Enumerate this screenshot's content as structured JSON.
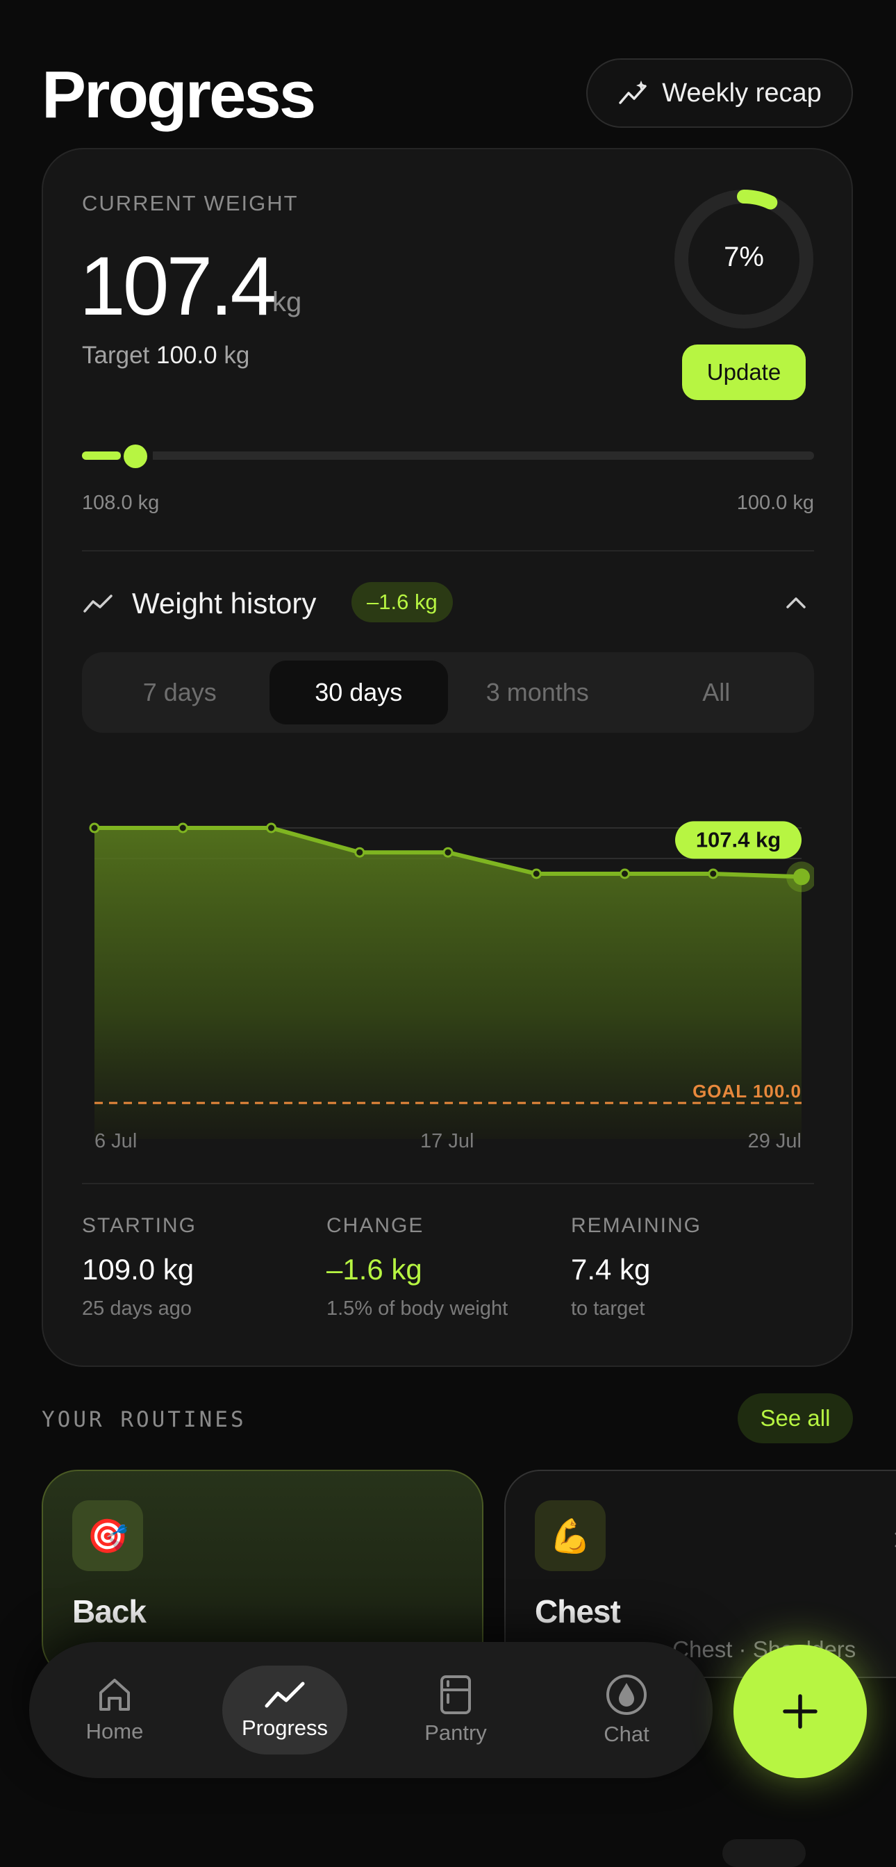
{
  "header": {
    "title": "Progress",
    "recap_label": "Weekly recap"
  },
  "weight": {
    "caption": "CURRENT WEIGHT",
    "value": "107.4",
    "unit": "kg",
    "target_prefix": "Target",
    "target_value": "100.0",
    "target_unit": "kg",
    "progress_pct": "7%",
    "progress_fraction": 0.07,
    "update_label": "Update",
    "slider_start": "108.0 kg",
    "slider_end": "100.0 kg",
    "slider_fraction": 0.07
  },
  "history": {
    "title": "Weight history",
    "badge": "–1.6 kg",
    "tabs": [
      {
        "label": "7 days",
        "active": false
      },
      {
        "label": "30 days",
        "active": true
      },
      {
        "label": "3 months",
        "active": false
      },
      {
        "label": "All",
        "active": false
      }
    ]
  },
  "chart_data": {
    "type": "area",
    "title": "",
    "x_tick_labels": [
      "6 Jul",
      "17 Jul",
      "29 Jul"
    ],
    "series": [
      {
        "values": [
          109.0,
          109.0,
          109.0,
          108.2,
          108.2,
          107.5,
          107.5,
          107.5,
          107.4
        ]
      }
    ],
    "latest_label": "107.4 kg",
    "goal": {
      "value": 100.0,
      "label": "GOAL 100.0"
    },
    "ylim": [
      99.5,
      109.5
    ],
    "grid": true,
    "colors": {
      "line": "#7fb521",
      "goal": "#e8883c",
      "badge": "#b7f542"
    }
  },
  "stats": [
    {
      "caption": "STARTING",
      "value": "109.0 kg",
      "sub": "25 days ago"
    },
    {
      "caption": "CHANGE",
      "value": "–1.6 kg",
      "sub": "1.5% of body weight"
    },
    {
      "caption": "REMAINING",
      "value": "7.4 kg",
      "sub": "to target"
    }
  ],
  "routines": {
    "label": "YOUR ROUTINES",
    "see_all": "See all",
    "items": [
      {
        "title": "Back",
        "emoji": "🎯",
        "icon": "target-icon",
        "sub": ""
      },
      {
        "title": "Chest",
        "emoji": "💪",
        "icon": "flexed-biceps-icon",
        "sub": "· Chest · Shoulders"
      }
    ]
  },
  "nav": {
    "items": [
      {
        "label": "Home",
        "icon": "home-icon",
        "active": false
      },
      {
        "label": "Progress",
        "icon": "trend-icon",
        "active": true
      },
      {
        "label": "Pantry",
        "icon": "fridge-icon",
        "active": false
      },
      {
        "label": "Chat",
        "icon": "chat-icon",
        "active": false
      }
    ],
    "fab_icon": "plus-icon"
  },
  "colors": {
    "accent": "#b7f542",
    "background": "#0b0b0b",
    "card": "#161616",
    "goal": "#e8883c"
  }
}
